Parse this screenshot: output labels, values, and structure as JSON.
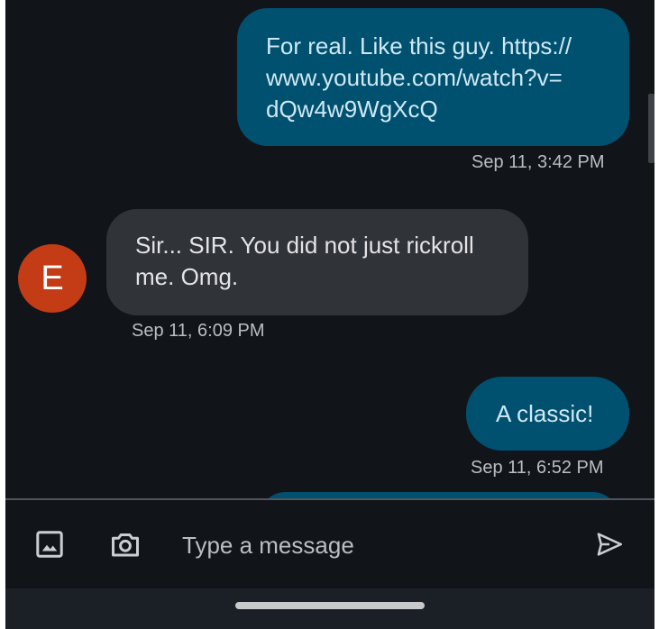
{
  "conversation": {
    "messages": [
      {
        "direction": "outgoing",
        "lines": [
          "For real. Like this guy. https://",
          "www.youtube.com/watch?v=",
          "dQw4w9WgXcQ"
        ],
        "timestamp": "Sep 11, 3:42 PM"
      },
      {
        "direction": "incoming",
        "avatar_letter": "E",
        "lines": [
          "Sir... SIR. You did not just rickroll",
          "me. Omg."
        ],
        "timestamp": "Sep 11, 6:09 PM"
      },
      {
        "direction": "outgoing",
        "lines": [
          "A classic!"
        ],
        "timestamp": "Sep 11, 6:52 PM"
      }
    ]
  },
  "compose": {
    "placeholder": "Type a message",
    "value": "",
    "gallery_icon": "image-icon",
    "camera_icon": "camera-icon",
    "send_icon": "send-icon"
  },
  "colors": {
    "background": "#11151a",
    "outgoing_bubble": "#005070",
    "incoming_bubble": "#303338",
    "avatar": "#c43c16",
    "timestamp_text": "#b9bec3"
  }
}
